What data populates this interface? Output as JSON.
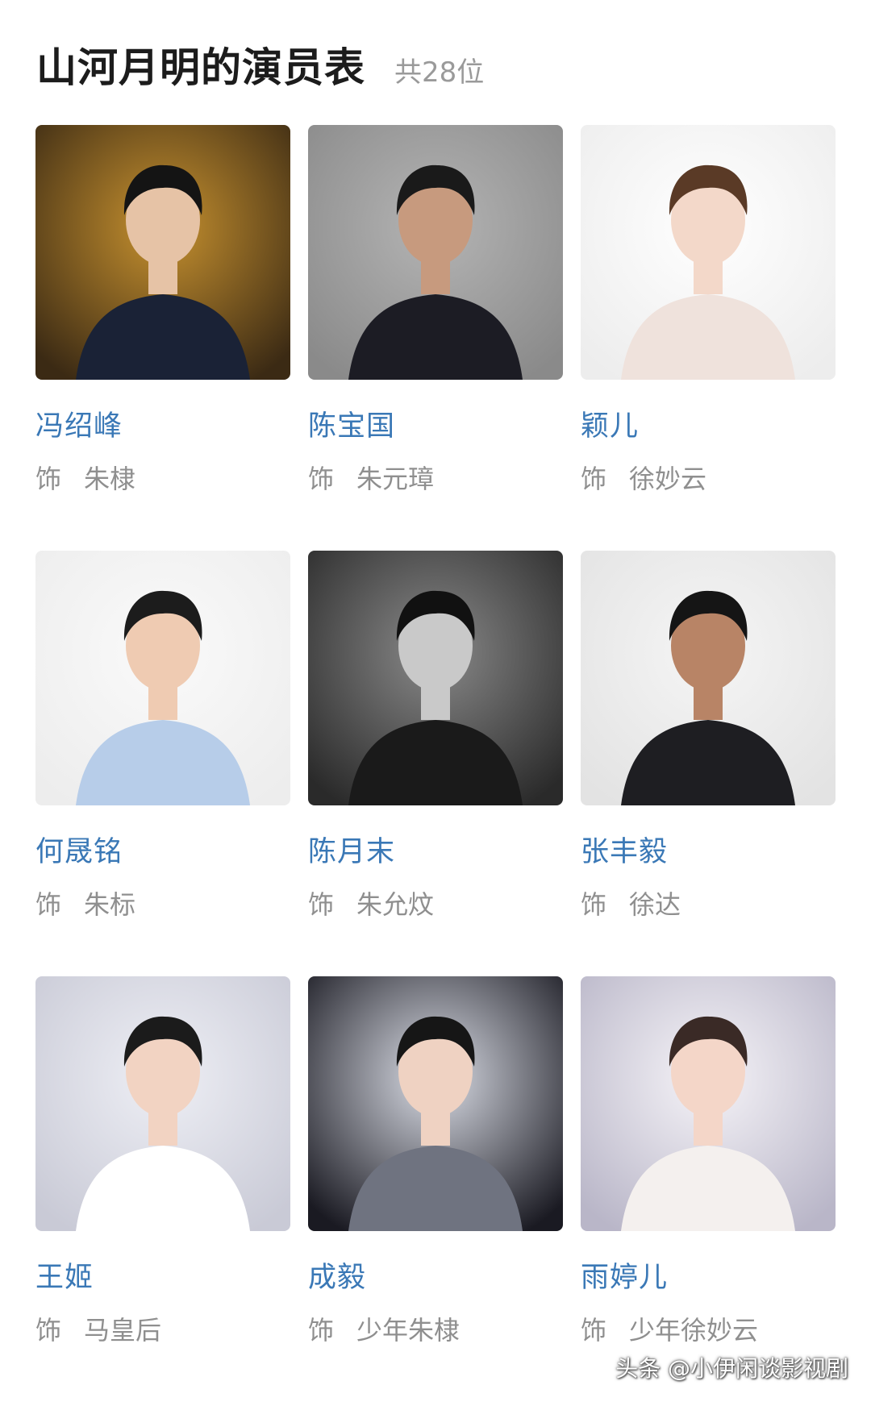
{
  "header": {
    "title": "山河月明的演员表",
    "count": "共28位"
  },
  "cast": [
    {
      "name": "冯绍峰",
      "prefix": "饰",
      "role": "朱棣",
      "bg": "#3b2a14",
      "bg2": "#c8922f",
      "shirt": "#1a2236",
      "skin": "#e6c3a6",
      "hair": "#141414"
    },
    {
      "name": "陈宝国",
      "prefix": "饰",
      "role": "朱元璋",
      "bg": "#8a8a8a",
      "bg2": "#b4b4b4",
      "shirt": "#1c1c24",
      "skin": "#c79a7e",
      "hair": "#1a1a1a"
    },
    {
      "name": "颖儿",
      "prefix": "饰",
      "role": "徐妙云",
      "bg": "#ededed",
      "bg2": "#ffffff",
      "shirt": "#efe2dc",
      "skin": "#f3d8c9",
      "hair": "#5a3a26"
    },
    {
      "name": "何晟铭",
      "prefix": "饰",
      "role": "朱标",
      "bg": "#ededed",
      "bg2": "#fafafa",
      "shirt": "#b7cde9",
      "skin": "#efcbb2",
      "hair": "#1c1c1c"
    },
    {
      "name": "陈月末",
      "prefix": "饰",
      "role": "朱允炆",
      "bg": "#2a2a2a",
      "bg2": "#8a8a8a",
      "shirt": "#1a1a1a",
      "skin": "#c9c9c9",
      "hair": "#111111"
    },
    {
      "name": "张丰毅",
      "prefix": "饰",
      "role": "徐达",
      "bg": "#e3e3e3",
      "bg2": "#f5f5f5",
      "shirt": "#1e1e22",
      "skin": "#b88466",
      "hair": "#151515"
    },
    {
      "name": "王姬",
      "prefix": "饰",
      "role": "马皇后",
      "bg": "#c9cad6",
      "bg2": "#eeeff5",
      "shirt": "#ffffff",
      "skin": "#f2d3c2",
      "hair": "#1b1b1b"
    },
    {
      "name": "成毅",
      "prefix": "饰",
      "role": "少年朱棣",
      "bg": "#1a1a22",
      "bg2": "#dcdfe8",
      "shirt": "#6f7380",
      "skin": "#efd2c2",
      "hair": "#161616"
    },
    {
      "name": "雨婷儿",
      "prefix": "饰",
      "role": "少年徐妙云",
      "bg": "#b9b6c8",
      "bg2": "#f6f4f8",
      "shirt": "#f4f0ee",
      "skin": "#f4d6c8",
      "hair": "#3a2a26"
    }
  ],
  "watermark": "头条 @小伊闲谈影视剧"
}
